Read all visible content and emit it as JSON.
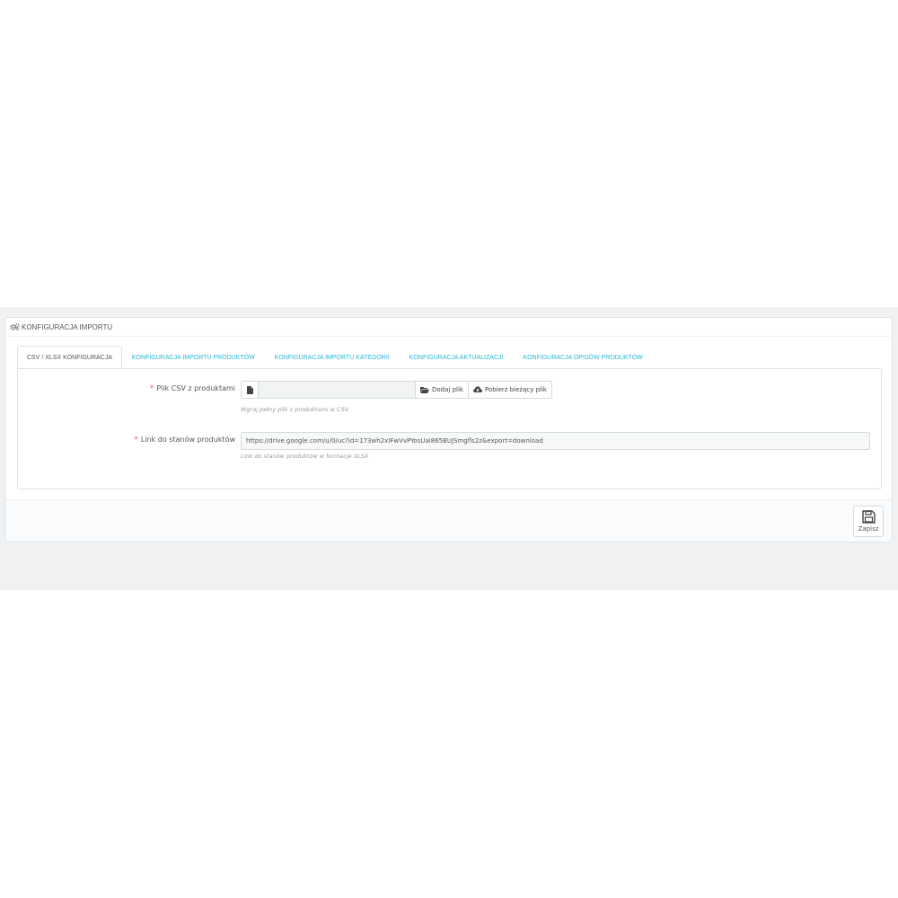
{
  "panel": {
    "title": "KONFIGURACJA IMPORTU",
    "icon": "cogs-icon"
  },
  "tabs": [
    {
      "label": "CSV / XLSX KONFIGURACJA",
      "active": true
    },
    {
      "label": "KONFIGURACJA IMPORTU PRODUKTÓW",
      "active": false
    },
    {
      "label": "KONFIGURACJA IMPORTU KATEGORII",
      "active": false
    },
    {
      "label": "KONFIGURACJA AKTUALIZACJI",
      "active": false
    },
    {
      "label": "KONFIGURACJA OPISÓW PRODUKTÓW",
      "active": false
    }
  ],
  "form": {
    "csv_file": {
      "required_mark": "*",
      "label": "Plik CSV z produktami",
      "value": "",
      "add_button": "Dodaj plik",
      "download_button": "Pobierz bieżący plik",
      "help": "Wgraj pełny plik z produktami w CSV"
    },
    "stock_link": {
      "required_mark": "*",
      "label": "Link do stanów produktów",
      "value": "https://drive.google.com/u/0/uc?id=173wh2xIFwVvPYosUal865BUJSmgfls2z&export=download",
      "help": "Link do stanów produktów w formacje XLSX"
    }
  },
  "footer": {
    "save_label": "Zapisz",
    "save_icon": "floppy-disk-icon"
  },
  "colors": {
    "accent": "#25b9d7",
    "required": "#e25d5d",
    "backdrop": "#eff1f2"
  }
}
